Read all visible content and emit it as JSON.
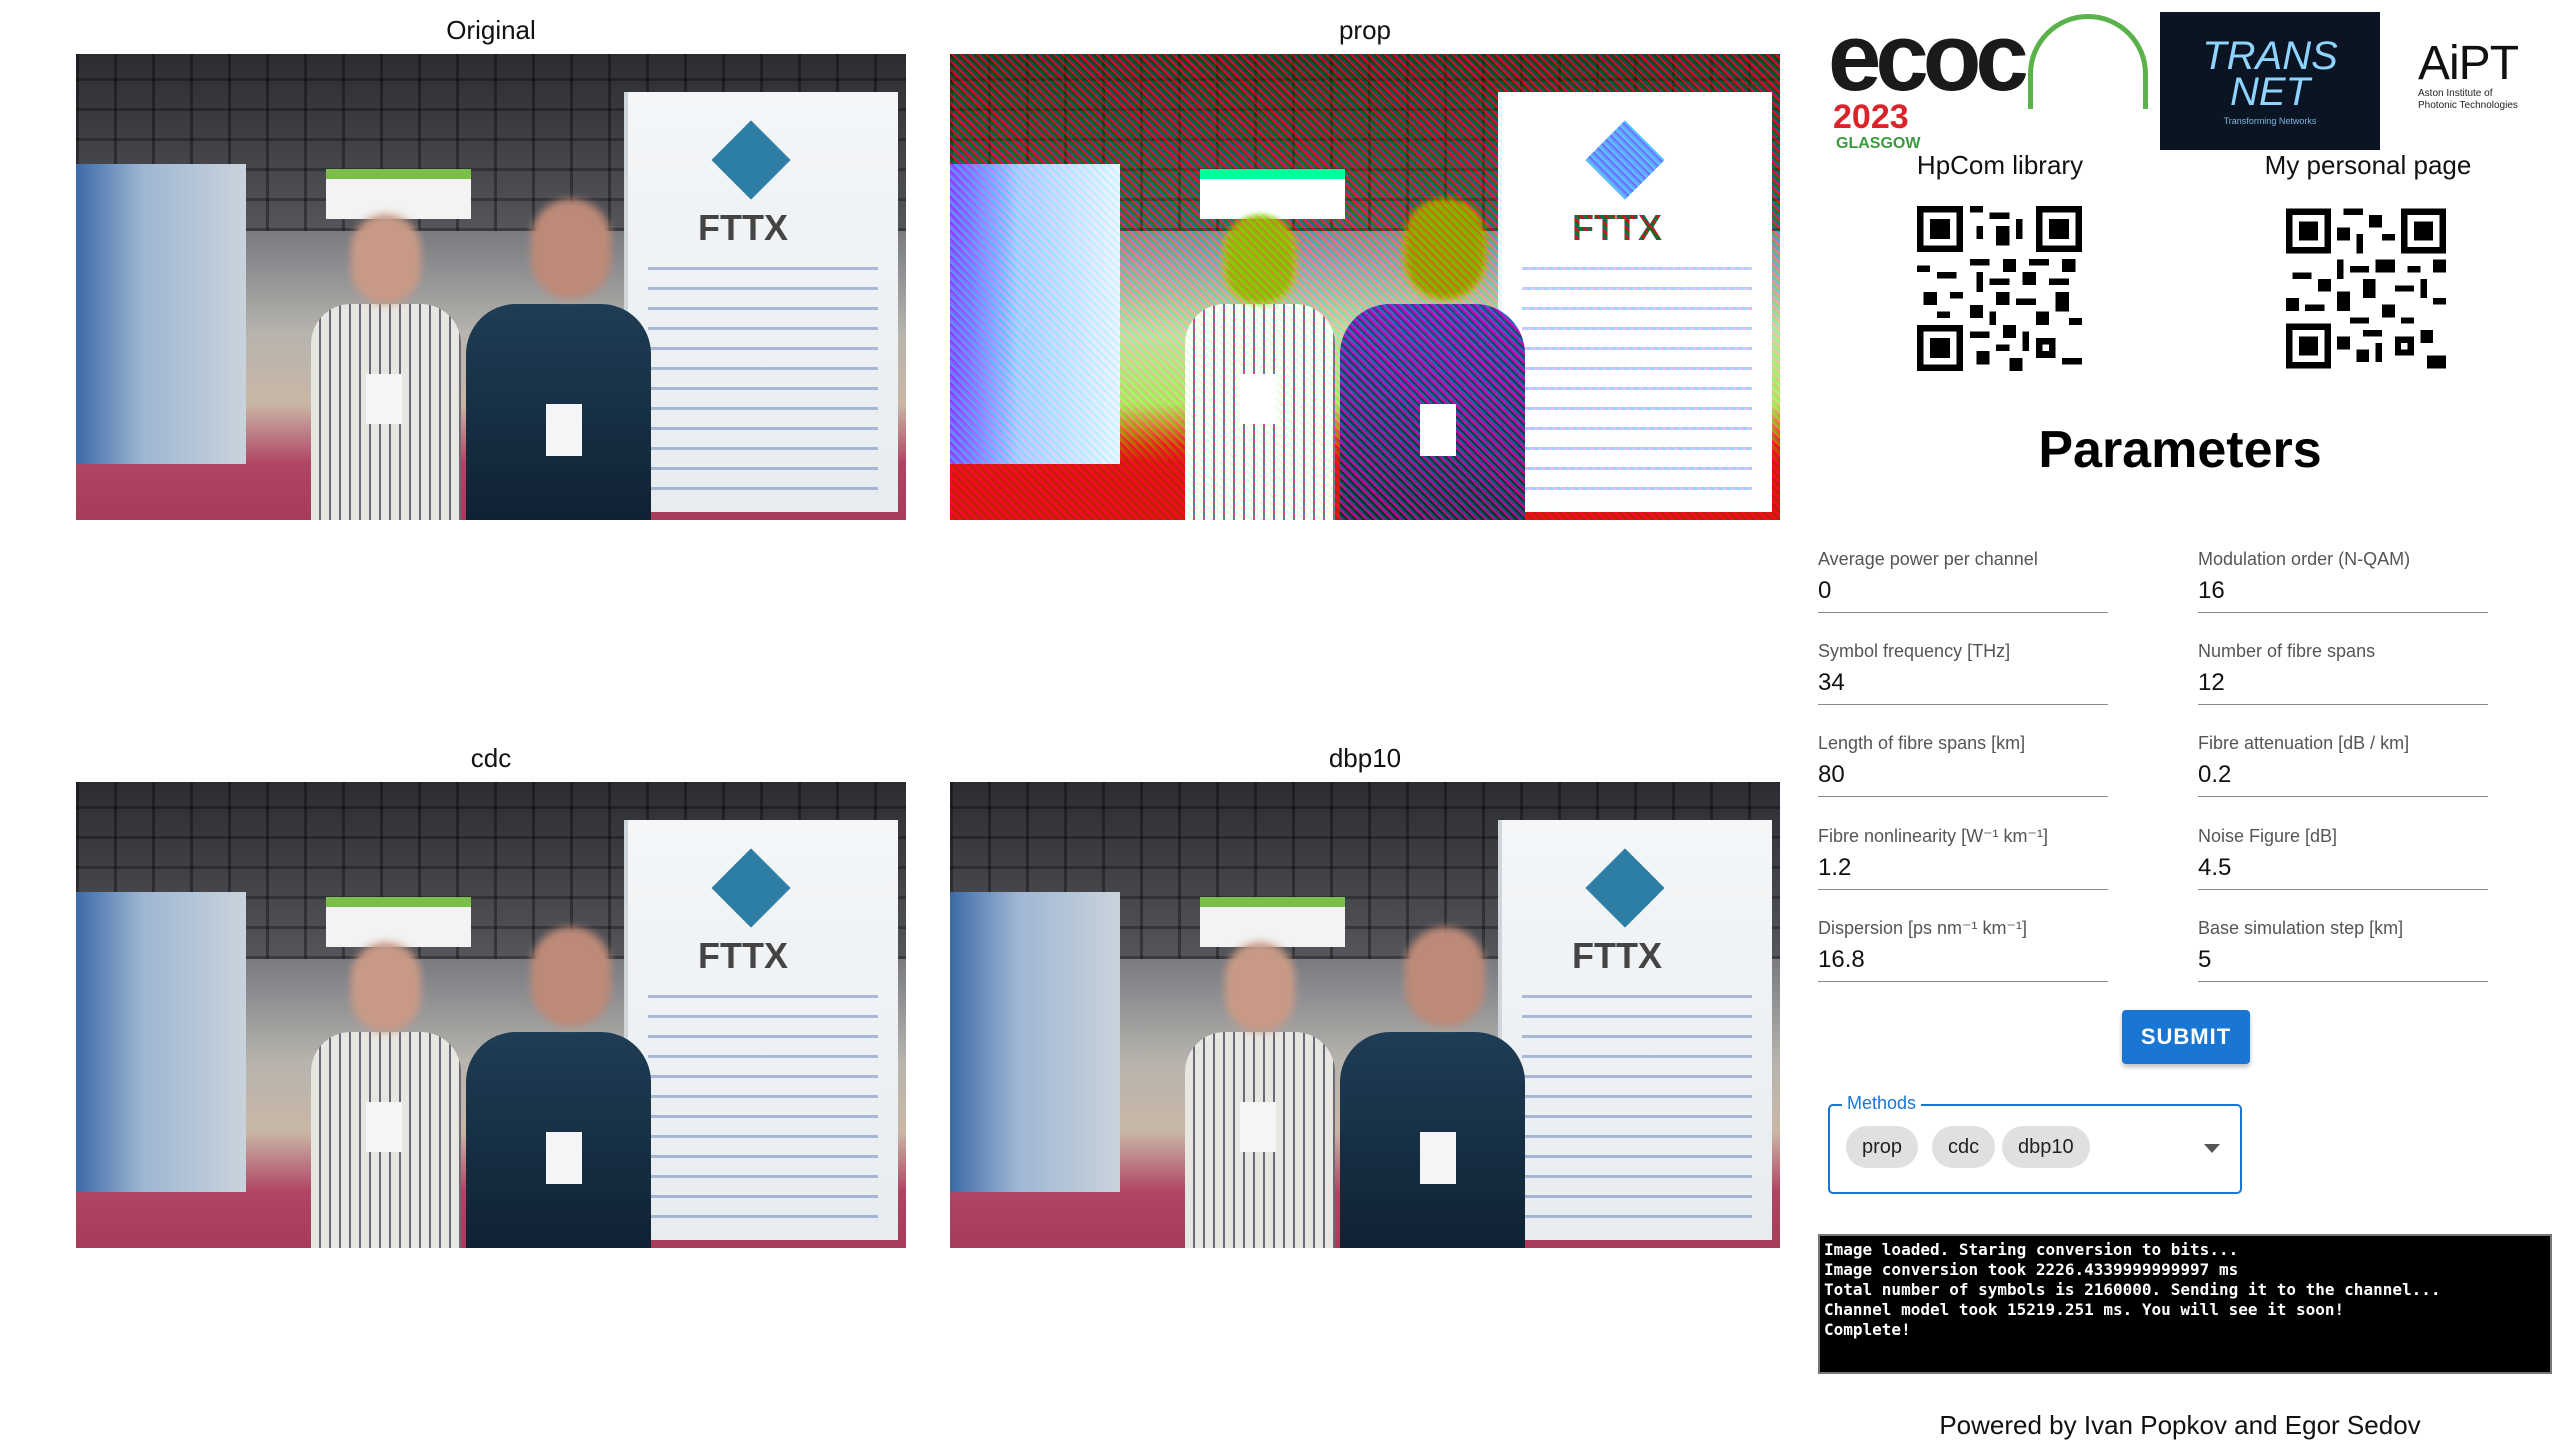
{
  "panels": [
    {
      "title": "Original",
      "variant": "original"
    },
    {
      "title": "prop",
      "variant": "prop"
    },
    {
      "title": "cdc",
      "variant": "cdc"
    },
    {
      "title": "dbp10",
      "variant": "dbp10"
    }
  ],
  "logos": {
    "ecoc": {
      "word": "ecoc",
      "year": "2023",
      "city": "GLASGOW"
    },
    "transnet": {
      "line1": "TRANS",
      "line2": "NET",
      "tagline": "Transforming Networks"
    },
    "aipt": {
      "name": "AiPT",
      "subtitle_1": "Aston Institute of",
      "subtitle_2": "Photonic Technologies"
    }
  },
  "qr_codes": {
    "library_label": "HpCom library",
    "personal_label": "My personal page"
  },
  "parameters": {
    "title": "Parameters",
    "fields": [
      {
        "label": "Average power per channel",
        "value": "0"
      },
      {
        "label": "Modulation order (N-QAM)",
        "value": "16"
      },
      {
        "label": "Symbol frequency [THz]",
        "value": "34"
      },
      {
        "label": "Number of fibre spans",
        "value": "12"
      },
      {
        "label": "Length of fibre spans [km]",
        "value": "80"
      },
      {
        "label": "Fibre attenuation [dB / km]",
        "value": "0.2"
      },
      {
        "label": "Fibre nonlinearity [W⁻¹ km⁻¹]",
        "value": "1.2"
      },
      {
        "label": "Noise Figure [dB]",
        "value": "4.5"
      },
      {
        "label": "Dispersion [ps nm⁻¹ km⁻¹]",
        "value": "16.8"
      },
      {
        "label": "Base simulation step [km]",
        "value": "5"
      }
    ],
    "submit_label": "SUBMIT"
  },
  "methods": {
    "legend": "Methods",
    "selected": [
      "prop",
      "cdc",
      "dbp10"
    ]
  },
  "console": {
    "lines": [
      "Image loaded. Staring conversion to bits...",
      "Image conversion took 2226.4339999999997 ms",
      "Total number of symbols is 2160000. Sending it to the channel...",
      "Channel model took 15219.251 ms. You will see it soon!",
      "Complete!"
    ]
  },
  "footer": "Powered by Ivan Popkov and Egor Sedov",
  "colors": {
    "accent": "#1976d2",
    "console_bg": "#000000"
  }
}
